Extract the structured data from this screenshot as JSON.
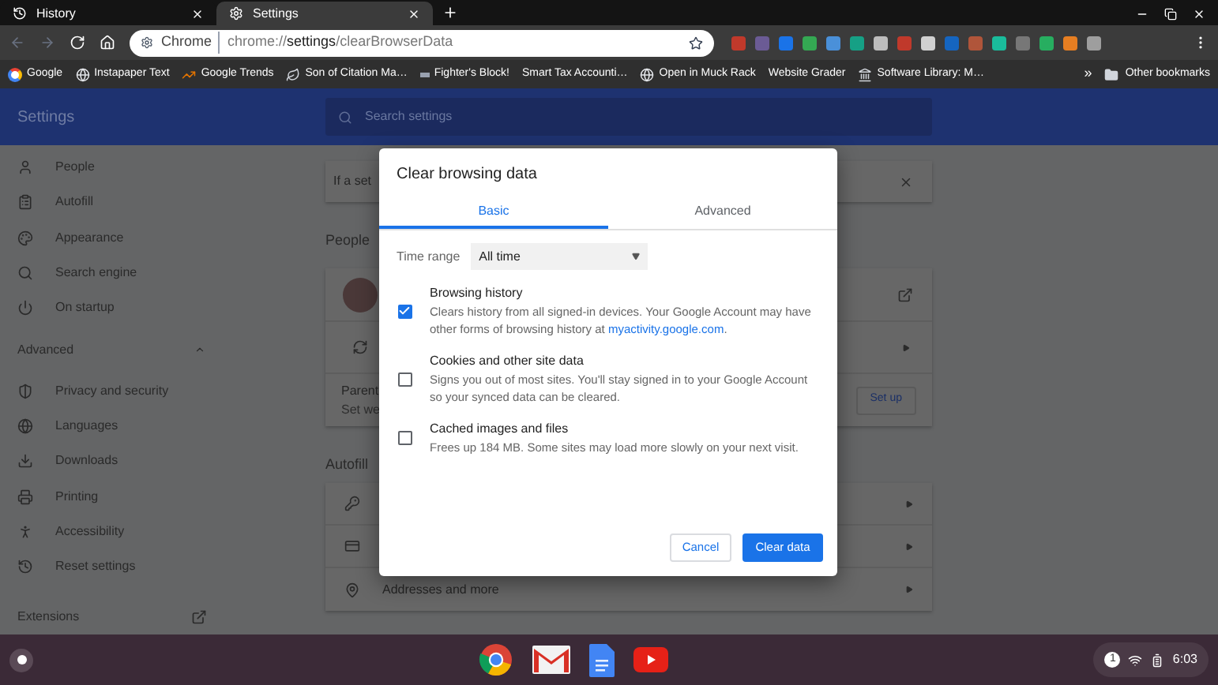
{
  "tabs": [
    {
      "title": "History",
      "selected": false
    },
    {
      "title": "Settings",
      "selected": true
    }
  ],
  "omnibox": {
    "site": "Chrome",
    "url": "chrome://**settings**/clearBrowserData"
  },
  "bookmarks": [
    {
      "label": "Google"
    },
    {
      "label": "Instapaper Text"
    },
    {
      "label": "Google Trends"
    },
    {
      "label": "Son of Citation Ma…"
    },
    {
      "label": "Fighter's Block!"
    },
    {
      "label": "Smart Tax Accounti…"
    },
    {
      "label": "Open in Muck Rack"
    },
    {
      "label": "Website Grader"
    },
    {
      "label": "Software Library: M…"
    }
  ],
  "bookmarks_overflow": "»",
  "other_bookmarks": "Other bookmarks",
  "settings_header": {
    "title": "Settings",
    "search_placeholder": "Search settings"
  },
  "sidebar": {
    "items": [
      {
        "label": "People"
      },
      {
        "label": "Autofill"
      },
      {
        "label": "Appearance"
      },
      {
        "label": "Search engine"
      },
      {
        "label": "On startup"
      }
    ],
    "advanced": {
      "label": "Advanced",
      "expanded": true
    },
    "advanced_items": [
      {
        "label": "Privacy and security"
      },
      {
        "label": "Languages"
      },
      {
        "label": "Downloads"
      },
      {
        "label": "Printing"
      },
      {
        "label": "Accessibility"
      },
      {
        "label": "Reset settings"
      }
    ],
    "extensions": "Extensions"
  },
  "main": {
    "notice": "If a set",
    "people_heading": "People",
    "parental_title": "Parent",
    "parental_subtitle": "Set we",
    "setup_button": "Set up",
    "autofill_heading": "Autofill",
    "autofill_rows": [
      {
        "kind": "passwords"
      },
      {
        "kind": "payments"
      },
      {
        "kind": "addresses",
        "label": "Addresses and more"
      }
    ]
  },
  "dialog": {
    "title": "Clear browsing data",
    "tabs": [
      {
        "label": "Basic",
        "selected": true
      },
      {
        "label": "Advanced",
        "selected": false
      }
    ],
    "time_range": {
      "label": "Time range",
      "value": "All time"
    },
    "items": [
      {
        "title": "Browsing history",
        "description": "Clears history from all signed-in devices. Your Google Account may have other forms of browsing history at ",
        "link": "myactivity.google.com",
        "description_end": ".",
        "checked": true
      },
      {
        "title": "Cookies and other site data",
        "description": "Signs you out of most sites. You'll stay signed in to your Google Account so your synced data can be cleared.",
        "checked": false
      },
      {
        "title": "Cached images and files",
        "description": "Frees up 184 MB. Some sites may load more slowly on your next visit.",
        "checked": false
      }
    ],
    "cancel": "Cancel",
    "confirm": "Clear data"
  },
  "shelf": {
    "notifications": "1",
    "time": "6:03"
  }
}
